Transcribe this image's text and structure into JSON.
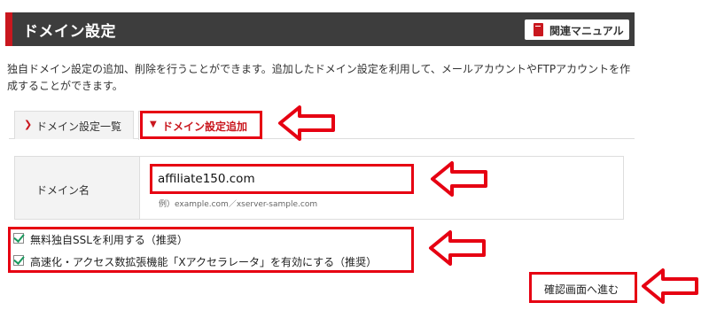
{
  "header": {
    "title": "ドメイン設定",
    "manual_label": "関連マニュアル",
    "manual_icon": "book-icon"
  },
  "description": "独自ドメイン設定の追加、削除を行うことができます。追加したドメイン設定を利用して、メールアカウントやFTPアカウントを作成することができます。",
  "tabs": [
    {
      "label": "ドメイン設定一覧",
      "icon": "chevron-right-icon",
      "active": false
    },
    {
      "label": "ドメイン設定追加",
      "icon": "chevron-down-icon",
      "active": true
    }
  ],
  "form": {
    "domain_label": "ドメイン名",
    "domain_value": "affiliate150.com",
    "example": "例）example.com／xserver-sample.com"
  },
  "options": [
    {
      "label": "無料独自SSLを利用する（推奨）",
      "checked": true
    },
    {
      "label": "高速化・アクセス数拡張機能「Xアクセラレータ」を有効にする（推奨）",
      "checked": true
    }
  ],
  "confirm_label": "確認画面へ進む",
  "colors": {
    "accent": "#c9171e",
    "highlight": "#e60012",
    "header_bg": "#3d3d3d",
    "check": "#1a9a5e"
  }
}
